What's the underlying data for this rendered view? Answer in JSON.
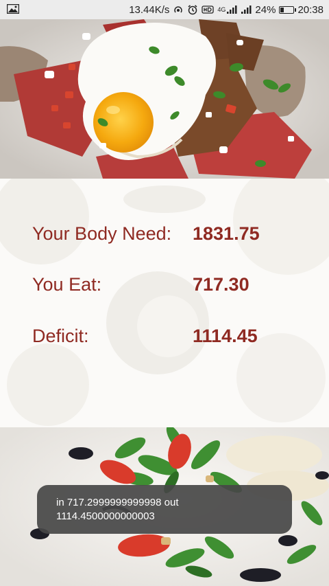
{
  "status_bar": {
    "net_speed": "13.44K/s",
    "network_type": "4G",
    "battery_percent": "24%",
    "battery_level": 0.24,
    "time": "20:38",
    "icons": [
      "image-icon",
      "hotspot-icon",
      "alarm-icon",
      "hd-icon",
      "signal-icon",
      "signal-2-icon",
      "battery-icon"
    ]
  },
  "stats": {
    "body_need_label": "Your Body Need:",
    "body_need_value": "1831.75",
    "you_eat_label": "You Eat:",
    "you_eat_value": "717.30",
    "deficit_label": "Deficit:",
    "deficit_value": "1114.45"
  },
  "toast": {
    "line1": "in 717.2999999999998 out",
    "line2": "1114.4500000000003"
  },
  "colors": {
    "accent": "#8f2a22",
    "status_bar_bg": "#ececec",
    "toast_bg": "#464646"
  }
}
